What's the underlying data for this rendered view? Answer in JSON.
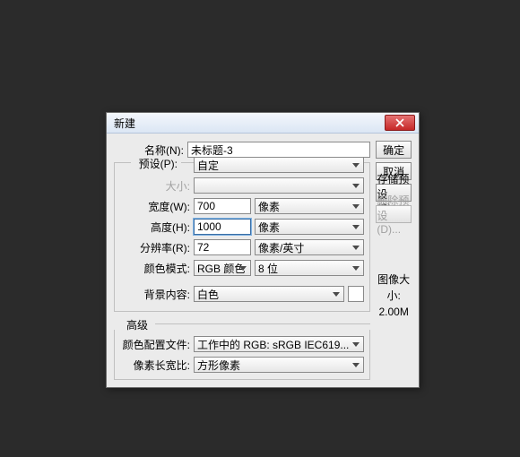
{
  "dialog": {
    "title": "新建",
    "name_label": "名称(N):",
    "name_value": "未标题-3",
    "preset_label": "预设(P):",
    "preset_value": "自定",
    "size_label": "大小:",
    "width_label": "宽度(W):",
    "width_value": "700",
    "width_unit": "像素",
    "height_label": "高度(H):",
    "height_value": "1000",
    "height_unit": "像素",
    "resolution_label": "分辨率(R):",
    "resolution_value": "72",
    "resolution_unit": "像素/英寸",
    "color_mode_label": "颜色模式:",
    "color_mode_value": "RGB 颜色",
    "color_depth_value": "8 位",
    "bg_label": "背景内容:",
    "bg_value": "白色",
    "advanced_label": "高级",
    "profile_label": "颜色配置文件:",
    "profile_value": "工作中的 RGB: sRGB IEC619...",
    "aspect_label": "像素长宽比:",
    "aspect_value": "方形像素"
  },
  "buttons": {
    "ok": "确定",
    "cancel": "取消",
    "save_preset": "存储预设(S)...",
    "delete_preset": "删除预设(D)..."
  },
  "info": {
    "size_label": "图像大小:",
    "size_value": "2.00M"
  }
}
